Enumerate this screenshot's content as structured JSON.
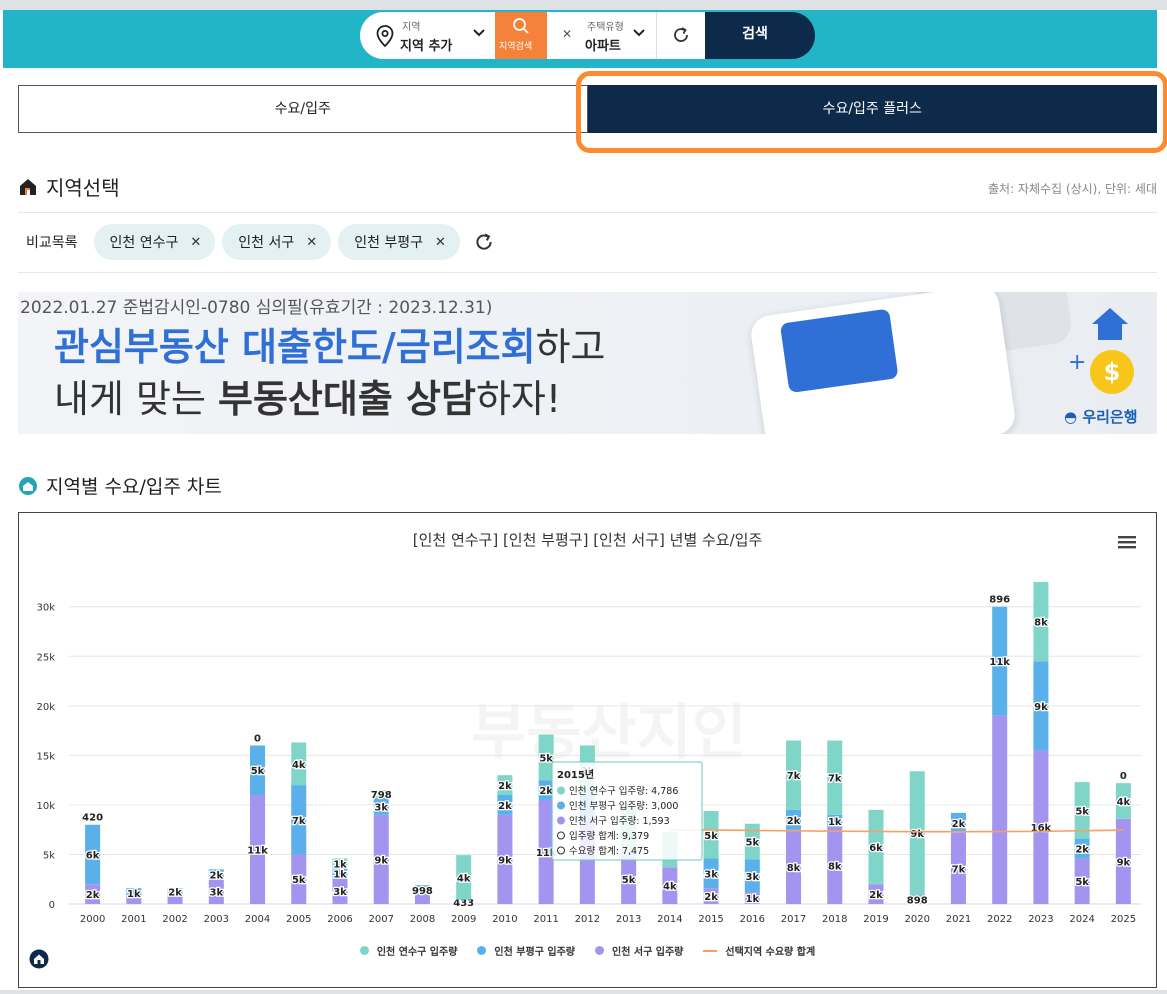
{
  "search": {
    "region_small": "지역",
    "region_value": "지역 추가",
    "search_label": "지역검색",
    "type_small": "주택유형",
    "type_value": "아파트",
    "go_label": "검색"
  },
  "tabs": [
    {
      "label": "수요/입주",
      "active": false
    },
    {
      "label": "수요/입주 플러스",
      "active": true
    }
  ],
  "region_section": {
    "title": "지역선택",
    "source": "출처: 자체수집 (상시), 단위: 세대",
    "compare_label": "비교목록",
    "chips": [
      "인천 연수구",
      "인천 서구",
      "인천 부평구"
    ]
  },
  "banner": {
    "line1": "2022.01.27 준법감시인-0780 심의필(유효기간 : 2023.12.31)",
    "line2_blue": "관심부동산 대출한도/금리조회",
    "line2_dark": "하고",
    "line3_a": "내게 맞는 ",
    "line3_b": "부동산대출 상담",
    "line3_c": "하자!",
    "bank": "우리은행",
    "coin": "$"
  },
  "chart_section": {
    "title": "지역별 수요/입주 차트"
  },
  "chart_data": {
    "type": "bar",
    "title": "[인천 연수구] [인천 부평구] [인천 서구] 년별 수요/입주",
    "categories": [
      "2000",
      "2001",
      "2002",
      "2003",
      "2004",
      "2005",
      "2006",
      "2007",
      "2008",
      "2009",
      "2010",
      "2011",
      "2012",
      "2013",
      "2014",
      "2015",
      "2016",
      "2017",
      "2018",
      "2019",
      "2020",
      "2021",
      "2022",
      "2023",
      "2024",
      "2025"
    ],
    "ylim": [
      0,
      32000
    ],
    "yticks": [
      "0",
      "5k",
      "10k",
      "15k",
      "20k",
      "25k",
      "30k"
    ],
    "stacked": true,
    "series": [
      {
        "name": "인천 서구 입주량",
        "color": "#a394f0",
        "values": [
          2000,
          600,
          900,
          2500,
          11000,
          5000,
          2600,
          9000,
          900,
          433,
          9000,
          10500,
          8500,
          5000,
          3700,
          1593,
          1200,
          7500,
          7800,
          2000,
          898,
          7200,
          19000,
          15500,
          4600,
          8600
        ],
        "labels": [
          "2k",
          "",
          "",
          "3k",
          "11k",
          "5k",
          "3k",
          "9k",
          "",
          "433",
          "9k",
          "11k",
          "",
          "5k",
          "4k",
          "2k",
          "1k",
          "8k",
          "8k",
          "2k",
          "898",
          "7k",
          "",
          "16k",
          "5k",
          "9k"
        ]
      },
      {
        "name": "인천 부평구 입주량",
        "color": "#5ab0ea",
        "values": [
          6000,
          1000,
          700,
          1000,
          5000,
          7000,
          1000,
          1700,
          998,
          0,
          2000,
          2000,
          2500,
          0,
          0,
          3000,
          3300,
          2000,
          1200,
          0,
          0,
          2000,
          11000,
          9000,
          2000,
          0
        ],
        "labels": [
          "6k",
          "1k",
          "2k",
          "2k",
          "5k",
          "7k",
          "1k",
          "3k",
          "998",
          "",
          "2k",
          "2k",
          "",
          "",
          "",
          "3k",
          "3k",
          "2k",
          "1k",
          "",
          "",
          "2k",
          "11k",
          "9k",
          "2k",
          ""
        ]
      },
      {
        "name": "인천 연수구 입주량",
        "color": "#7fd6c8",
        "values": [
          0,
          0,
          0,
          0,
          0,
          4300,
          1000,
          800,
          0,
          4500,
          2000,
          4600,
          5000,
          5000,
          3600,
          4786,
          3600,
          7000,
          7500,
          7500,
          12500,
          0,
          0,
          8000,
          5700,
          3600
        ],
        "labels": [
          "",
          "",
          "",
          "",
          "0",
          "4k",
          "1k",
          "798",
          "",
          "4k",
          "2k",
          "5k",
          "3k",
          "",
          "",
          "5k",
          "5k",
          "7k",
          "7k",
          "6k",
          "9k",
          "",
          "896",
          "8k",
          "5k",
          "4k"
        ]
      }
    ],
    "top_labels": [
      "420",
      "",
      "",
      "",
      "",
      "",
      "",
      "",
      "",
      "",
      "",
      "",
      "",
      "",
      "",
      "",
      "",
      "",
      "",
      "",
      "",
      "",
      "",
      "",
      "",
      "0"
    ],
    "demand_line": {
      "name": "선택지역 수요량 합계",
      "color": "#f5a06a",
      "start_index": 14,
      "values": [
        7475,
        7475,
        7420,
        7380,
        7350,
        7320,
        7300,
        7300,
        7310,
        7330,
        7400,
        7450
      ]
    },
    "tooltip": {
      "year": "2015년",
      "rows": [
        "인천 연수구 입주량: 4,786",
        "인천 부평구 입주량: 3,000",
        "인천 서구 입주량: 1,593",
        "입주량 합계: 9,379",
        "수요량 합계: 7,475"
      ]
    },
    "legend": [
      "인천 연수구 입주량",
      "인천 부평구 입주량",
      "인천 서구 입주량",
      "선택지역 수요량 합계"
    ],
    "legend_colors": [
      "#7fd6c8",
      "#5ab0ea",
      "#a394f0",
      "#f5a06a"
    ],
    "watermark": "부동산지인"
  }
}
